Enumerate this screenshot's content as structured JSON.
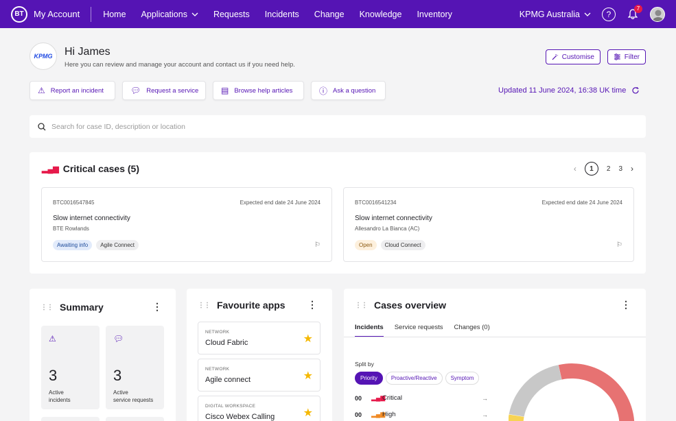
{
  "nav": {
    "logo": "BT",
    "brand": "My Account",
    "links": [
      "Home",
      "Applications",
      "Requests",
      "Incidents",
      "Change",
      "Knowledge",
      "Inventory"
    ],
    "org": "KPMG Australia",
    "notifications": "7",
    "help": "?"
  },
  "header": {
    "company_logo": "KPMG",
    "greeting": "Hi James",
    "subtitle": "Here you can review and manage your account and contact us if you need help.",
    "customise_label": "Customise",
    "filter_label": "Filter"
  },
  "quick_actions": [
    {
      "label": "Report an incident",
      "icon": "warning-icon"
    },
    {
      "label": "Request a service",
      "icon": "chat-icon"
    },
    {
      "label": "Browse help articles",
      "icon": "document-icon"
    },
    {
      "label": "Ask a question",
      "icon": "question-icon"
    }
  ],
  "updated": "Updated 11 June 2024, 16:38 UK time",
  "search": {
    "placeholder": "Search for case ID, description or location"
  },
  "critical": {
    "title": "Critical cases (5)",
    "pages": [
      "1",
      "2",
      "3"
    ],
    "cases": [
      {
        "id": "BTC0016547845",
        "end": "Expected end date 24 June 2024",
        "title": "Slow internet connectivity",
        "user": "BTE Rowlands",
        "status": "Awaiting info",
        "product": "Agile Connect"
      },
      {
        "id": "BTC0016541234",
        "end": "Expected end date 24 June 2024",
        "title": "Slow internet connectivity",
        "user": "Allesandro La Bianca (AC)",
        "status": "Open",
        "product": "Cloud Connect"
      }
    ]
  },
  "summary": {
    "title": "Summary",
    "stats": [
      {
        "value": "3",
        "line1": "Active",
        "line2": "incidents"
      },
      {
        "value": "3",
        "line1": "Active",
        "line2": "service requests"
      }
    ]
  },
  "favourites": {
    "title": "Favourite apps",
    "apps": [
      {
        "category": "NETWORK",
        "name": "Cloud Fabric"
      },
      {
        "category": "NETWORK",
        "name": "Agile connect"
      },
      {
        "category": "DIGITAL WORKSPACE",
        "name": "Cisco Webex Calling"
      }
    ]
  },
  "overview": {
    "title": "Cases overview",
    "tabs": [
      "Incidents",
      "Service requests",
      "Changes (0)"
    ],
    "split_label": "Split by",
    "pills": [
      "Priority",
      "Proactive/Reactive",
      "Symptom"
    ],
    "rows": [
      {
        "count": "00",
        "label": "Critical",
        "color": "#e61a4b"
      },
      {
        "count": "00",
        "label": "High",
        "color": "#f08a24"
      }
    ],
    "donut_colors": [
      "#e77272",
      "#c8c8c8",
      "#f7d354"
    ]
  }
}
